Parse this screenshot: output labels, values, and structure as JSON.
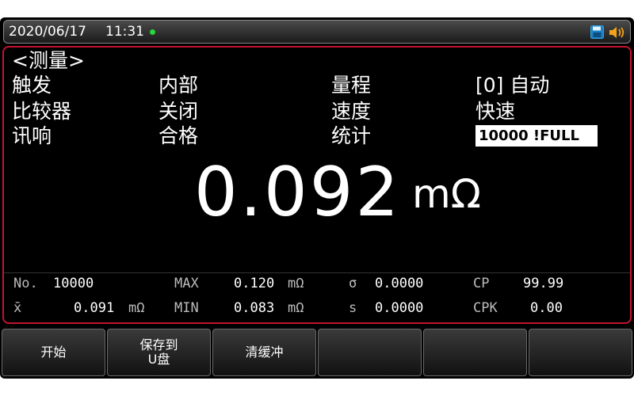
{
  "status": {
    "date": "2020/06/17",
    "time": "11:31"
  },
  "icons": {
    "save": "save-disk-icon",
    "beep": "beep-speaker-icon"
  },
  "colors": {
    "frame": "#c4122f",
    "live_dot": "#27d63a",
    "save_icon": "#29a3e0",
    "beep_icon": "#f2a31a"
  },
  "page_title": "<测量>",
  "settings": {
    "trigger_label": "触发",
    "trigger_value": "内部",
    "range_label": "量程",
    "range_value": "[0] 自动",
    "comparator_label": "比较器",
    "comparator_value": "关闭",
    "speed_label": "速度",
    "speed_value": "快速",
    "beep_label": "讯响",
    "beep_value": "合格",
    "stats_label": "统计",
    "stats_value": "10000 !FULL"
  },
  "reading": {
    "value": "0.092",
    "unit": "mΩ"
  },
  "stats": {
    "no_label": "No.",
    "no_value": "10000",
    "max_label": "MAX",
    "max_value": "0.120",
    "max_unit": "mΩ",
    "sigma_label": "σ",
    "sigma_value": "0.0000",
    "cp_label": "CP",
    "cp_value": "99.99",
    "mean_label": "x̄",
    "mean_value": "0.091",
    "mean_unit": "mΩ",
    "min_label": "MIN",
    "min_value": "0.083",
    "min_unit": "mΩ",
    "s_label": "s",
    "s_value": "0.0000",
    "cpk_label": "CPK",
    "cpk_value": "0.00"
  },
  "softkeys": [
    "开始",
    "保存到\nU盘",
    "清缓冲",
    "",
    "",
    ""
  ]
}
